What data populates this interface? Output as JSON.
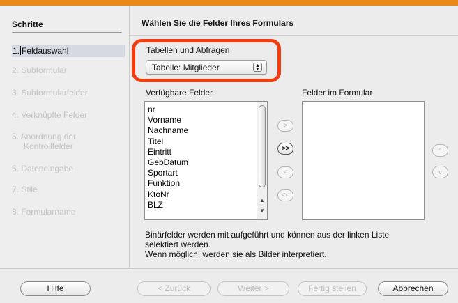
{
  "steps": {
    "title": "Schritte",
    "items": [
      {
        "number": "1.",
        "label": "Feldauswahl"
      },
      {
        "label": "2. Subformular"
      },
      {
        "label": "3. Subformularfelder"
      },
      {
        "label": "4. Verknüpfte Felder"
      },
      {
        "label": "5. Anordnung der",
        "label2": "Kontrollfelder"
      },
      {
        "label": "6. Dateneingabe"
      },
      {
        "label": "7. Stile"
      },
      {
        "label": "8. Formularname"
      }
    ]
  },
  "main": {
    "title": "Wählen Sie die Felder Ihres Formulars",
    "tables_label": "Tabellen und Abfragen",
    "table_select_value": "Tabelle: Mitglieder",
    "available_label": "Verfügbare Felder",
    "form_fields_label": "Felder im Formular",
    "available_fields": [
      "nr",
      "Vorname",
      "Nachname",
      "Titel",
      "Eintritt",
      "GebDatum",
      "Sportart",
      "Funktion",
      "KtoNr",
      "BLZ"
    ],
    "form_fields": [],
    "info_line1": "Binärfelder werden mit aufgeführt und können aus der linken Liste",
    "info_line2": "selektiert werden.",
    "info_line3": "Wenn möglich, werden sie als Bilder interpretiert."
  },
  "transfer_buttons": {
    "add": ">",
    "add_all": ">>",
    "remove": "<",
    "remove_all": "<<",
    "up": "^",
    "down": "v"
  },
  "footer": {
    "help": "Hilfe",
    "back": "< Zurück",
    "next": "Weiter >",
    "finish": "Fertig stellen",
    "cancel": "Abbrechen"
  },
  "colors": {
    "accent_bar": "#e8891a",
    "highlight": "#f23c14"
  }
}
